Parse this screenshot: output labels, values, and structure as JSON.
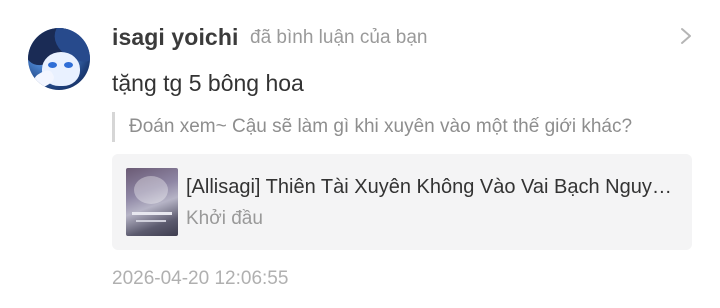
{
  "notification": {
    "username": "isagi yoichi",
    "action": "đã bình luận của bạn",
    "comment": "tặng tg 5 bông hoa",
    "quoted_comment": "Đoán xem~ Cậu sẽ làm gì khi xuyên vào một thế giới khác?",
    "story": {
      "title": "[Allisagi] Thiên Tài Xuyên Không Vào Vai Bạch Nguyệt Quang",
      "chapter": "Khởi đầu"
    },
    "timestamp": "2026-04-20 12:06:55"
  },
  "icons": {
    "open": "chevron-right-icon"
  },
  "colors": {
    "username": "#3b3b3b",
    "secondary_text": "#9a9a9a",
    "card_background": "#f4f4f5"
  }
}
